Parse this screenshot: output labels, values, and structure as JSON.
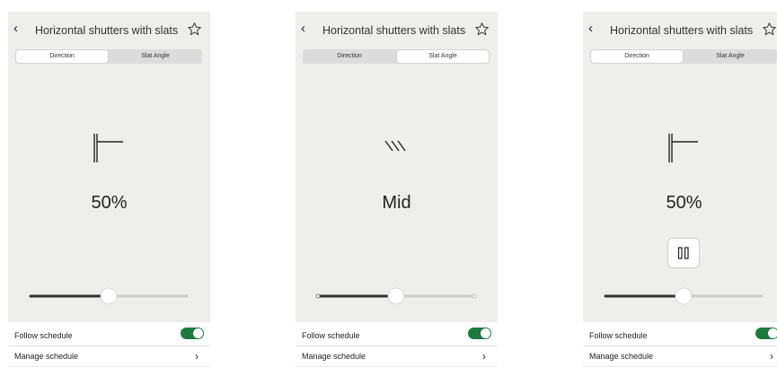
{
  "screens": [
    {
      "title": "Horizontal shutters with slats",
      "segment": {
        "left": "Direction",
        "right": "Slat Angle",
        "active": "left"
      },
      "icon": "slat-direction-icon",
      "value": "50%",
      "slider": {
        "level": 0.5,
        "end_markers": false
      },
      "pause_button": false,
      "follow_schedule": {
        "label": "Follow schedule",
        "on": true
      },
      "manage_schedule": {
        "label": "Manage schedule"
      }
    },
    {
      "title": "Horizontal shutters with slats",
      "segment": {
        "left": "Direction",
        "right": "Slat Angle",
        "active": "right"
      },
      "icon": "slat-angle-icon",
      "value": "Mid",
      "slider": {
        "level": 0.5,
        "end_markers": true
      },
      "pause_button": false,
      "follow_schedule": {
        "label": "Follow schedule",
        "on": true
      },
      "manage_schedule": {
        "label": "Manage schedule"
      }
    },
    {
      "title": "Horizontal shutters with slats",
      "segment": {
        "left": "Direction",
        "right": "Slat Angle",
        "active": "left"
      },
      "icon": "slat-direction-icon",
      "value": "50%",
      "slider": {
        "level": 0.5,
        "end_markers": false
      },
      "pause_button": true,
      "follow_schedule": {
        "label": "Follow schedule",
        "on": true
      },
      "manage_schedule": {
        "label": "Manage schedule"
      }
    }
  ],
  "colors": {
    "panel": "#eeeeec",
    "segment_track": "#dcdcdc",
    "slider_fill": "#333333",
    "slider_track": "#cccccc",
    "toggle_on": "#1c7a3e"
  }
}
